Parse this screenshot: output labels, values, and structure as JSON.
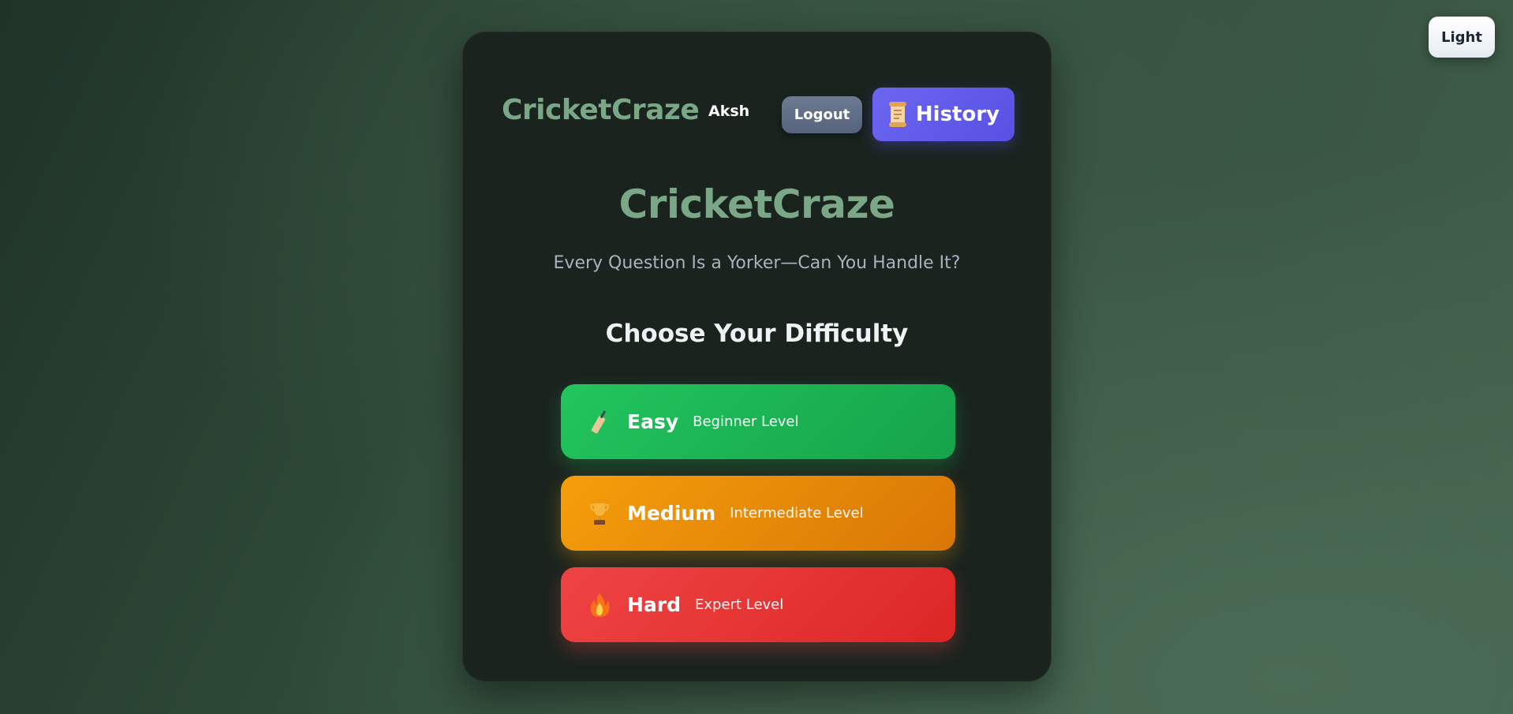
{
  "theme_toggle": {
    "label": "Light"
  },
  "header": {
    "brand": "CricketCraze",
    "username": "Aksh",
    "logout_label": "Logout",
    "history_label": "History",
    "history_icon": "scroll-icon"
  },
  "main": {
    "title": "CricketCraze",
    "subtitle": "Every Question Is a Yorker—Can You Handle It?",
    "section_heading": "Choose Your Difficulty"
  },
  "difficulties": [
    {
      "name": "Easy",
      "description": "Beginner Level",
      "icon": "cricket-bat-icon",
      "color": "#22c55e"
    },
    {
      "name": "Medium",
      "description": "Intermediate Level",
      "icon": "trophy-icon",
      "color": "#f59e0b"
    },
    {
      "name": "Hard",
      "description": "Expert Level",
      "icon": "fire-icon",
      "color": "#ef4444"
    }
  ],
  "colors": {
    "brand_green": "#7aa886",
    "history_purple": "#6d66f2",
    "card_background": "#1a231e"
  }
}
